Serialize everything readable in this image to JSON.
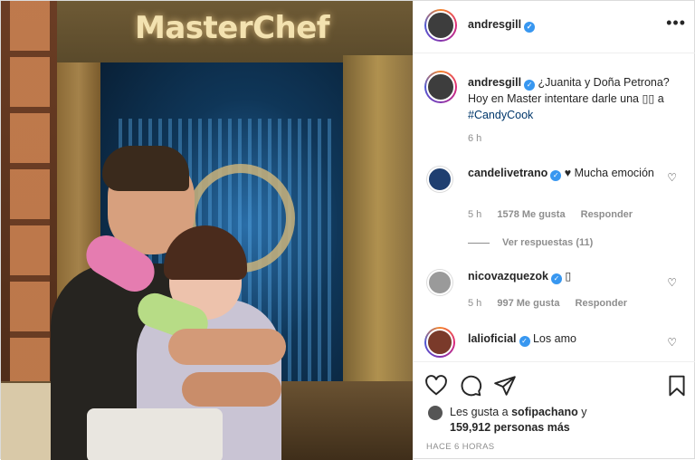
{
  "post": {
    "image_brand_text": "MasterChef",
    "author": "andresgill",
    "more_icon": "more-horizontal-icon"
  },
  "caption": {
    "username": "andresgill",
    "text": "¿Juanita y Doña Petrona? Hoy en Master intentare darle una ",
    "emoji_placeholder": "▯▯",
    "text_after": "a ",
    "hashtag": "#CandyCook",
    "time": "6 h"
  },
  "comments": [
    {
      "username": "candelivetrano",
      "text": "♥ Mucha emoción",
      "time": "5 h",
      "likes": "1578 Me gusta",
      "reply": "Responder",
      "view_replies": "Ver respuestas (11)"
    },
    {
      "username": "nicovazquezok",
      "text": "▯",
      "time": "5 h",
      "likes": "997 Me gusta",
      "reply": "Responder"
    },
    {
      "username": "lalioficial",
      "text": "Los amo"
    }
  ],
  "likes": {
    "prefix": "Les gusta a ",
    "user": "sofipachano",
    "connector": " y",
    "count": "159,912 personas más"
  },
  "timestamp": "HACE 6 HORAS",
  "colors": {
    "verified": "#3897f0",
    "hashtag": "#00376b",
    "muted": "#8e8e8e"
  }
}
